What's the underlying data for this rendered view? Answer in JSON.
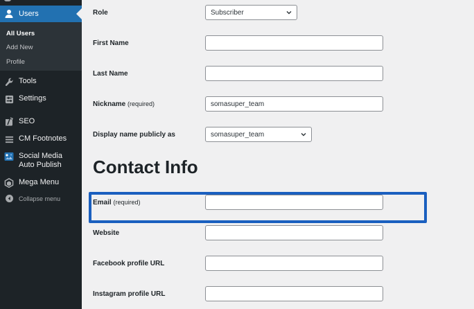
{
  "sidebar": {
    "active": {
      "label": "Users",
      "icon": "user-icon"
    },
    "submenu": [
      {
        "label": "All Users",
        "current": true
      },
      {
        "label": "Add New",
        "current": false
      },
      {
        "label": "Profile",
        "current": false
      }
    ],
    "items": [
      {
        "label": "Tools",
        "icon": "wrench-icon"
      },
      {
        "label": "Settings",
        "icon": "settings-icon"
      },
      {
        "label": "SEO",
        "icon": "seo-icon"
      },
      {
        "label": "CM Footnotes",
        "icon": "footnotes-icon"
      },
      {
        "label": "Social Media Auto Publish",
        "icon": "social-icon"
      },
      {
        "label": "Mega Menu",
        "icon": "megamenu-icon"
      }
    ],
    "collapse_label": "Collapse menu"
  },
  "form": {
    "role": {
      "label": "Role",
      "value": "Subscriber"
    },
    "first_name": {
      "label": "First Name",
      "value": ""
    },
    "last_name": {
      "label": "Last Name",
      "value": ""
    },
    "nickname": {
      "label": "Nickname",
      "required": "(required)",
      "value": "somasuper_team"
    },
    "display_name": {
      "label": "Display name publicly as",
      "value": "somasuper_team"
    }
  },
  "contact": {
    "title": "Contact Info",
    "email": {
      "label": "Email",
      "required": "(required)",
      "value": ""
    },
    "website": {
      "label": "Website",
      "value": ""
    },
    "facebook": {
      "label": "Facebook profile URL",
      "value": ""
    },
    "instagram": {
      "label": "Instagram profile URL",
      "value": ""
    }
  },
  "colors": {
    "sidebar_bg": "#1d2327",
    "accent": "#2271b1",
    "highlight": "#1a5fbf",
    "content_bg": "#f0f0f1"
  }
}
